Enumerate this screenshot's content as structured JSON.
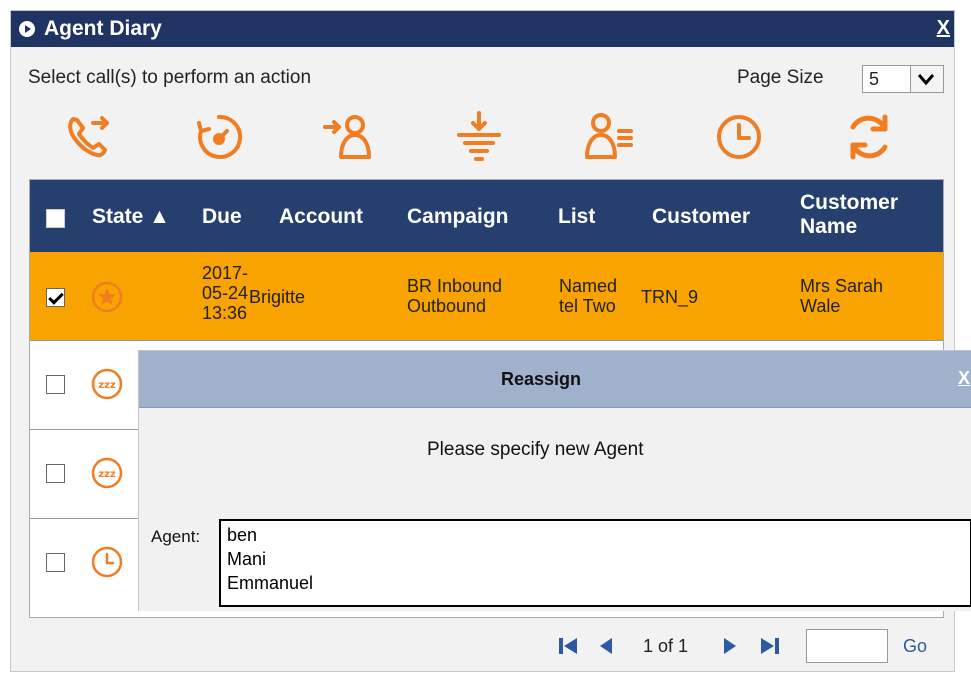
{
  "window": {
    "title": "Agent Diary",
    "close_label": "X"
  },
  "toolbar": {
    "instruction": "Select call(s) to perform an action",
    "page_size_label": "Page Size",
    "page_size_value": "5",
    "tools": [
      {
        "name": "transfer-call-icon"
      },
      {
        "name": "snooze-timer-icon"
      },
      {
        "name": "reassign-agent-icon"
      },
      {
        "name": "filter-icon"
      },
      {
        "name": "agent-list-icon"
      },
      {
        "name": "clock-icon"
      },
      {
        "name": "refresh-icon"
      }
    ]
  },
  "grid": {
    "headers": {
      "state": "State ▲",
      "due": "Due",
      "account": "Account",
      "campaign": "Campaign",
      "list": "List",
      "customer": "Customer",
      "customer_name_1": "Customer",
      "customer_name_2": "Name"
    },
    "rows": [
      {
        "selected": true,
        "state_icon": "star-icon",
        "due": [
          "2017-",
          "05-24",
          "13:36"
        ],
        "account": "Brigitte",
        "campaign": [
          "BR Inbound",
          "Outbound"
        ],
        "list": [
          "Named",
          "tel Two"
        ],
        "customer": "TRN_9",
        "customer_name": [
          "Mrs Sarah",
          "Wale"
        ]
      },
      {
        "selected": false,
        "state_icon": "snooze-icon"
      },
      {
        "selected": false,
        "state_icon": "snooze-icon"
      },
      {
        "selected": false,
        "state_icon": "clock-icon"
      }
    ]
  },
  "pager": {
    "page_text": "1 of 1",
    "go_label": "Go"
  },
  "dialog": {
    "title": "Reassign",
    "close_label": "X",
    "message": "Please specify new Agent",
    "agent_label": "Agent:",
    "agents": [
      "ben",
      "Mani",
      "Emmanuel"
    ]
  },
  "colors": {
    "title_bar": "#1f3463",
    "grid_header": "#253f6f",
    "selected_row": "#f8a300",
    "icon_orange": "#f07d22",
    "pager_blue": "#2c5aa0",
    "dialog_title": "#9fb1cb"
  }
}
